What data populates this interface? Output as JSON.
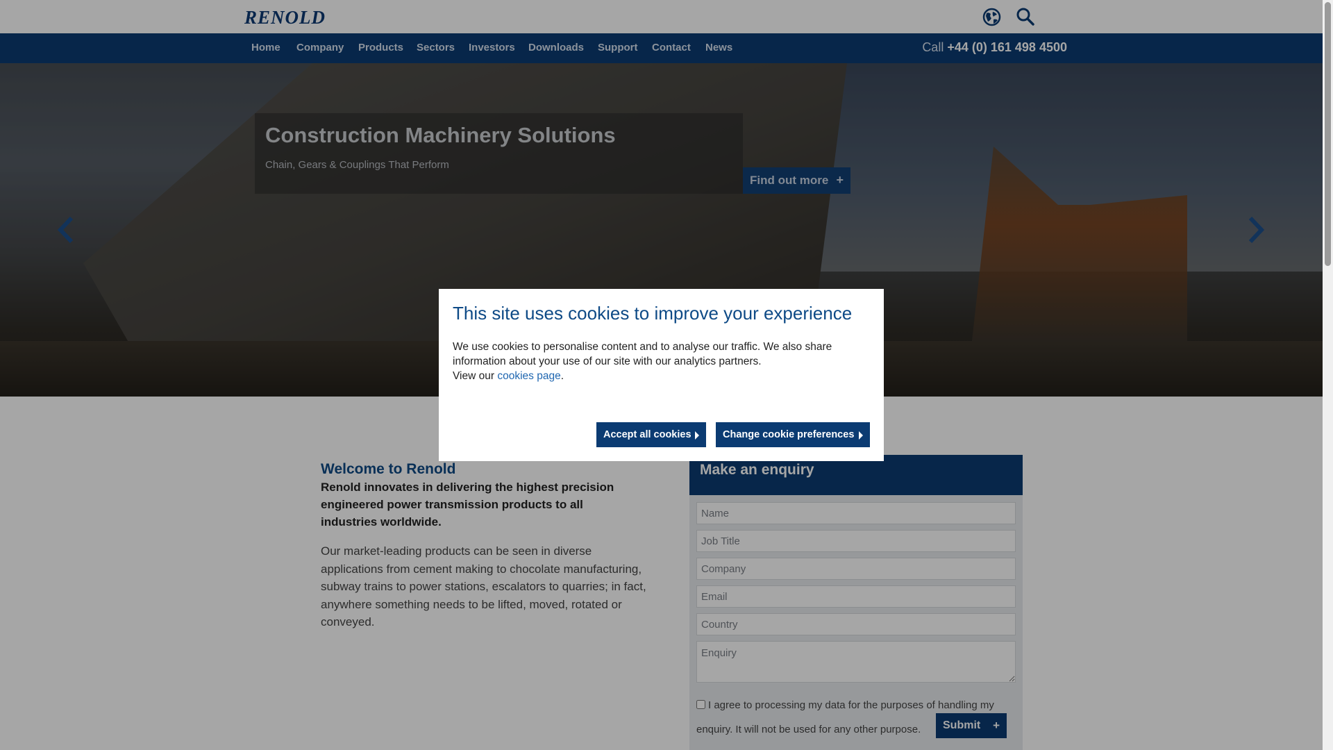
{
  "header": {
    "logo_text": "RENOLD",
    "icons": [
      "globe-icon",
      "search-icon"
    ]
  },
  "nav": {
    "items": [
      "Home",
      "Company",
      "Products",
      "Sectors",
      "Investors",
      "Downloads",
      "Support",
      "Contact",
      "News"
    ],
    "phone_prefix": "Call",
    "phone_number": "+44 (0) 161 498 4500"
  },
  "hero": {
    "title": "Construction Machinery Solutions",
    "subtitle": "Chain, Gears & Couplings That Perform",
    "cta_label": "Find out more",
    "cta_icon": "+",
    "prev_icon": "chevron-left-icon",
    "next_icon": "chevron-right-icon"
  },
  "welcome": {
    "title": "Welcome to Renold",
    "lead": "Renold innovates in delivering the highest precision engineered power transmission products to all industries worldwide.",
    "body": "Our market-leading products can be seen in diverse applications from cement making to chocolate manufacturing, subway trains to power stations, escalators to quarries; in fact, anywhere something needs to be lifted, moved, rotated or conveyed."
  },
  "enquiry": {
    "title": "Make an enquiry",
    "fields": {
      "name": "Name",
      "job_title": "Job Title",
      "company": "Company",
      "email": "Email",
      "country": "Country",
      "enquiry": "Enquiry"
    },
    "consent_text": "I agree to processing my data for the purposes of handling my enquiry. It will not be used for any other purpose.",
    "submit_label": "Submit",
    "submit_icon": "+"
  },
  "cookie_modal": {
    "title": "This site uses cookies to improve your experience",
    "message": "We use cookies to personalise content and to analyse our traffic. We also share information about your use of our site with our analytics partners.",
    "view_prefix": "View our",
    "link_text": "cookies page",
    "link_suffix": ".",
    "accept_label": "Accept all cookies",
    "change_label": "Change cookie preferences"
  },
  "colors": {
    "brand_navy": "#0b3b72",
    "heading_blue": "#0e4a86",
    "link_blue": "#1f66b0"
  }
}
